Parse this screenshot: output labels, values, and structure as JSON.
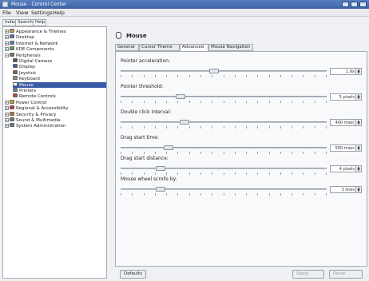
{
  "window": {
    "title": "Mouse - Control Center",
    "controls": [
      "minimize",
      "maximize",
      "close"
    ]
  },
  "menubar": [
    "File",
    "View",
    "Settings",
    "Help"
  ],
  "left_tabs": [
    "Index",
    "Search",
    "Help"
  ],
  "tree": [
    {
      "label": "Appearance & Themes",
      "level": 0,
      "icon": "appearance-icon",
      "color": "#c0a040"
    },
    {
      "label": "Desktop",
      "level": 0,
      "icon": "desktop-icon",
      "color": "#5070b0"
    },
    {
      "label": "Internet & Network",
      "level": 0,
      "icon": "globe-icon",
      "color": "#4090c0"
    },
    {
      "label": "KDE Components",
      "level": 0,
      "icon": "components-icon",
      "color": "#60a060"
    },
    {
      "label": "Peripherals",
      "level": 0,
      "icon": "peripherals-icon",
      "color": "#707070"
    },
    {
      "label": "Digital Camera",
      "level": 1,
      "icon": "camera-icon",
      "color": "#505050"
    },
    {
      "label": "Display",
      "level": 1,
      "icon": "display-icon",
      "color": "#4060a0"
    },
    {
      "label": "Joystick",
      "level": 1,
      "icon": "joystick-icon",
      "color": "#806040"
    },
    {
      "label": "Keyboard",
      "level": 1,
      "icon": "keyboard-icon",
      "color": "#909090"
    },
    {
      "label": "Mouse",
      "level": 1,
      "icon": "mouse-icon",
      "color": "#ffffff"
    },
    {
      "label": "Printers",
      "level": 1,
      "icon": "printer-icon",
      "color": "#6080a0"
    },
    {
      "label": "Remote Controls",
      "level": 1,
      "icon": "remote-icon",
      "color": "#c04040"
    },
    {
      "label": "Power Control",
      "level": 0,
      "icon": "power-icon",
      "color": "#d0a020"
    },
    {
      "label": "Regional & Accessibility",
      "level": 0,
      "icon": "regional-icon",
      "color": "#c03030"
    },
    {
      "label": "Security & Privacy",
      "level": 0,
      "icon": "security-icon",
      "color": "#b08020"
    },
    {
      "label": "Sound & Multimedia",
      "level": 0,
      "icon": "sound-icon",
      "color": "#707070"
    },
    {
      "label": "System Administration",
      "level": 0,
      "icon": "admin-icon",
      "color": "#5080a0"
    }
  ],
  "selected_item": "Mouse",
  "page_title": "Mouse",
  "page_tabs": [
    "General",
    "Cursor Theme",
    "Advanced",
    "Mouse Navigation"
  ],
  "active_tab": "Advanced",
  "settings": [
    {
      "label": "Pointer acceleration:",
      "value": "1.9x",
      "level": 0.45
    },
    {
      "label": "Pointer threshold:",
      "value": "5 pixels",
      "level": 0.28
    },
    {
      "label": "Double click interval:",
      "value": "400 msec",
      "level": 0.3
    },
    {
      "label": "Drag start time:",
      "value": "500 msec",
      "level": 0.22
    },
    {
      "label": "Drag start distance:",
      "value": "4 pixels",
      "level": 0.18
    },
    {
      "label": "Mouse wheel scrolls by:",
      "value": "3 lines",
      "level": 0.18
    }
  ],
  "buttons": {
    "defaults": "Defaults",
    "apply": "Apply",
    "reset": "Reset"
  },
  "colors": {
    "selection": "#3a5aa5",
    "titlebar": "#4a70b5"
  }
}
